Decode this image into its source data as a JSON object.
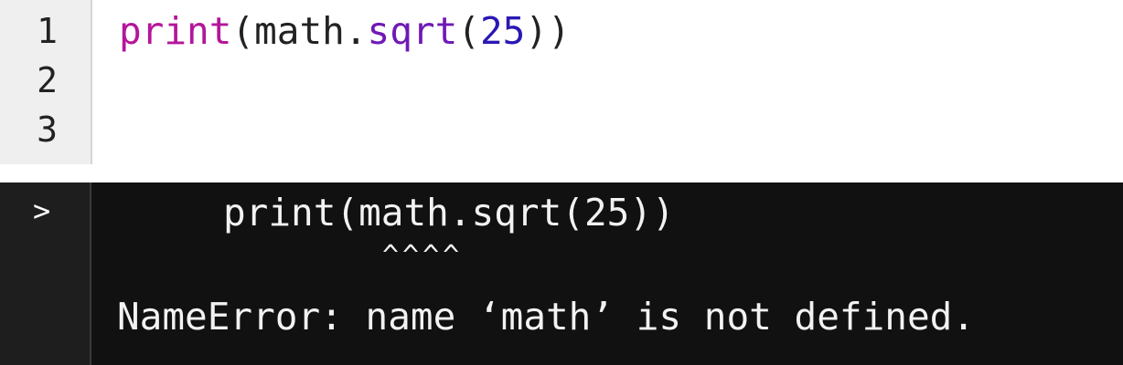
{
  "editor": {
    "line_numbers": [
      "1",
      "2",
      "3"
    ],
    "line1_tokens": {
      "builtin": "print",
      "open_paren": "(",
      "object": "math",
      "dot": ".",
      "func": "sqrt",
      "open_paren_2": "(",
      "number": "25",
      "close_parens": "))"
    },
    "colors": {
      "builtin": "#b4159a",
      "function": "#6f1ab4",
      "number": "#2a18b4",
      "text": "#222222"
    }
  },
  "console": {
    "prompt": ">",
    "output_lines": [
      "print(math.sqrt(25))",
      "^^^^",
      "NameError: name ‘math’ is not defined."
    ],
    "colors": {
      "background": "#111111",
      "text": "#f2f2f2"
    }
  }
}
